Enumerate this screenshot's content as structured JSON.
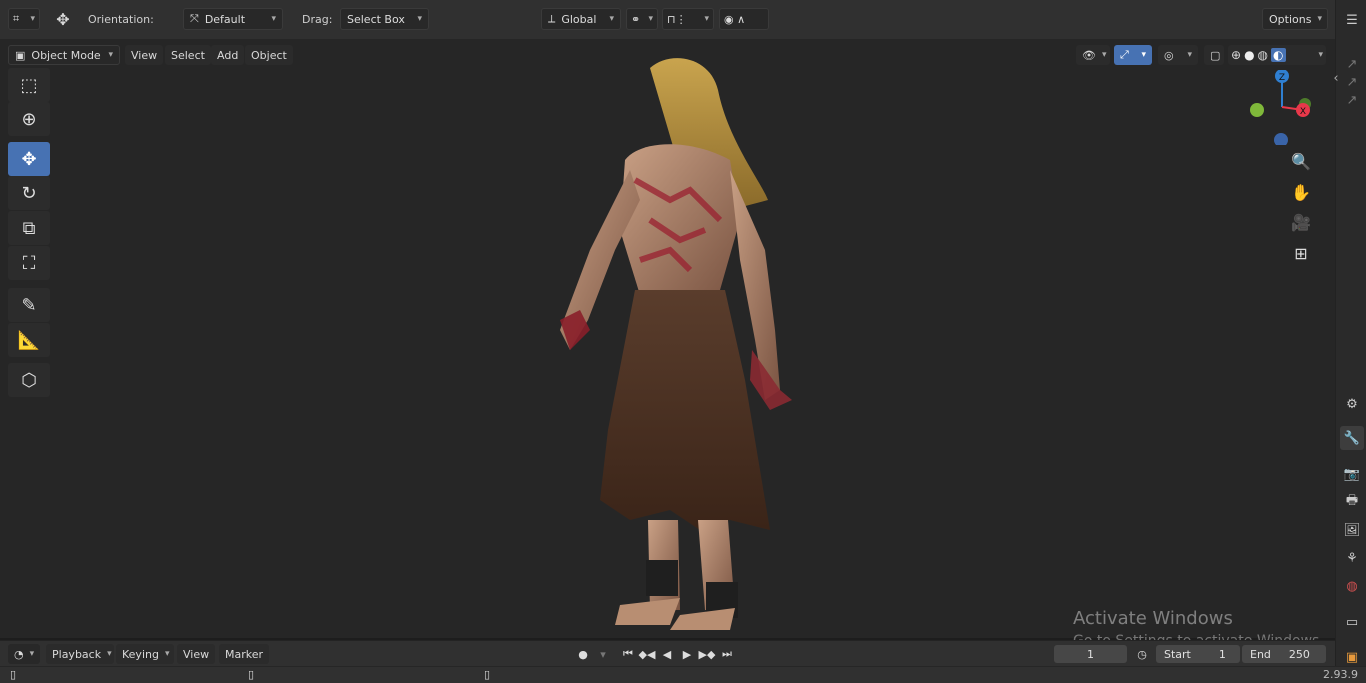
{
  "header": {
    "orientation_label": "Orientation:",
    "orientation_value": "Default",
    "drag_label": "Drag:",
    "drag_value": "Select Box",
    "transform_orientation": "Global",
    "options_label": "Options"
  },
  "viewport_header": {
    "mode": "Object Mode",
    "menus": [
      "View",
      "Select",
      "Add",
      "Object"
    ]
  },
  "gizmo": {
    "z_label": "Z",
    "x_label": "X"
  },
  "overlay": {
    "activate_title": "Activate Windows",
    "activate_sub": "Go to Settings to activate Windows."
  },
  "timeline": {
    "menus": [
      "Playback",
      "Keying",
      "View",
      "Marker"
    ],
    "current_frame": "1",
    "start_label": "Start",
    "start_value": "1",
    "end_label": "End",
    "end_value": "250"
  },
  "status": {
    "version": "2.93.9"
  },
  "colors": {
    "accent": "#4772b3",
    "gizmo_z": "#2f7fd1",
    "gizmo_x": "#e8384a",
    "gizmo_y": "#7fb83a"
  },
  "icons": [
    "editor-type-icon",
    "transform-icon",
    "select-box-icon",
    "cursor-icon",
    "move-icon",
    "rotate-icon",
    "scale-icon",
    "transform-tool-icon",
    "annotate-icon",
    "measure-icon",
    "add-cube-icon",
    "zoom-icon",
    "hand-icon",
    "camera-icon",
    "grid-icon"
  ]
}
